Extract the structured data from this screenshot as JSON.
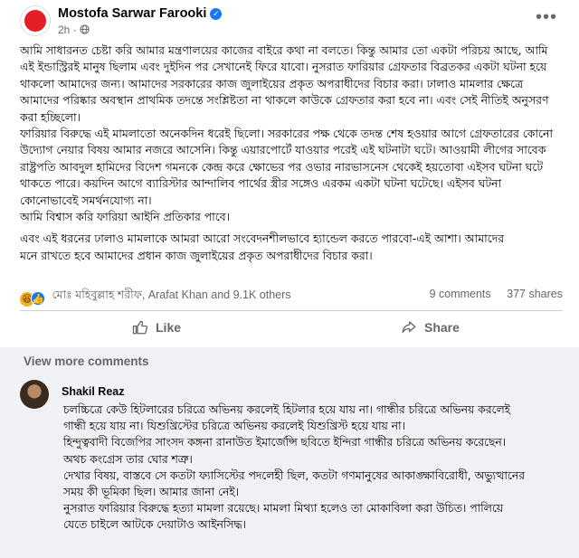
{
  "post": {
    "author": "Mostofa Sarwar Farooki",
    "time": "2h",
    "verified_icon": "verified-badge-icon",
    "privacy_icon": "globe-icon",
    "body": [
      "আমি সাধারনত চেষ্টা করি আমার মন্ত্রণালয়ের কাজের বাইরে কথা না বলতে। কিন্তু আমার তো একটা পরিচয় আছে, আমি এই ইন্ডাস্ট্রিরই মানুষ ছিলাম এবং দুইদিন পর সেখানেই ফিরে যাবো। নুসরাত ফারিয়ার গ্রেফতার বিব্রতকর একটা ঘটনা হয়ে থাকলো আমাদের জন্য। আমাদের সরকারের কাজ জুলাইয়ের প্রকৃত অপরাধীদের বিচার করা। ঢালাও মামলার ক্ষেত্রে আমাদের পরিষ্কার অবস্থান প্রাথমিক তদন্তে সংশ্লিষ্টতা না থাকলে কাউকে গ্রেফতার করা হবে না। এবং সেই নীতিই অনুসরণ করা হচ্ছিলো।",
      "ফারিয়ার বিরুদ্ধে এই মামলাতো অনেকদিন ধরেই ছিলো। সরকারের পক্ষ থেকে তদন্ত শেষ হওয়ার আগে গ্রেফতারের কোনো উদ্যোগ নেয়ার বিষয় আমার নজরে আসেনি। কিন্তু এয়ারপোর্টে যাওয়ার পরেই এই ঘটনাটা ঘটে। আওয়ামী লীগের সাবেক রাষ্ট্রপতি আবদুল হামিদের বিদেশ গমনকে কেন্দ্র করে ক্ষোভের পর ওভার নারভাসনেস থেকেই হয়তোবা এইসব ঘটনা ঘটে থাকতে পারে। কয়দিন আগে ব্যারিস্টার আন্দালিব পার্থের স্ত্রীর সঙ্গেও এরকম একটা ঘটনা ঘটেছে। এইসব ঘটনা কোনোভাবেই সমর্থনযোগ্য না।",
      "আমি বিশ্বাস করি ফারিয়া আইনি প্রতিকার পাবে।",
      "এবং এই ধরনের ঢালাও মামলাকে আমরা আরো সংবেদনশীলভাবে হ্যান্ডেল করতে পারবো-এই আশা। আমাদের",
      "মনে রাখতে হবে আমাদের প্রধান কাজ জুলাইয়ের প্রকৃত অপরাধীদের বিচার করা।"
    ],
    "reactions_text": "মোঃ মহিবুল্লাহ শরীফ, Arafat Khan and 9.1K others",
    "comments_count": "9 comments",
    "shares_count": "377 shares",
    "like_label": "Like",
    "share_label": "Share"
  },
  "comments": {
    "view_more": "View more comments",
    "items": [
      {
        "author": "Shakil Reaz",
        "lines": [
          "চলচ্চিত্রে কেউ হিটলারের চরিত্রে অভিনয় করলেই হিটলার হয়ে যায় না। গান্ধীর চরিত্রে অভিনয় করলেই গান্ধী হয়ে যায় না। যিশুখ্রিস্টের চরিত্রে অভিনয় করলেই যিশুখ্রিস্ট হয়ে যায় না।",
          "হিন্দুত্ববাদী বিজেপির সাংসদ কঙ্গনা রানাউত ইমার্জেন্সি ছবিতে ইন্দিরা গান্ধীর চরিত্রে অভিনয় করেছেন। অথচ কংগ্রেস তার ঘোর শত্রু।",
          "দেখার বিষয়, বাস্তবে সে কতটা ফ্যাসিস্টের পদলেহী ছিল, কতটা গণমানুষের আকাঙ্ক্ষাবিরোধী, অভ্যুত্থানের সময় কী ভূমিকা ছিল। আমার জানা নেই।",
          "নুসরাত ফারিয়ার বিরুদ্ধে হত্যা মামলা রয়েছে। মামলা মিথ্যা হলেও তা মোকাবিলা করা উচিত। পালিয়ে যেতে চাইলে আটকে দেয়াটাও আইনসিদ্ধ।"
        ]
      }
    ]
  },
  "colors": {
    "brand_red": "#e41e26",
    "verified_blue": "#1877f2",
    "secondary_text": "#65676b",
    "comment_bg": "#f0f2f5"
  }
}
